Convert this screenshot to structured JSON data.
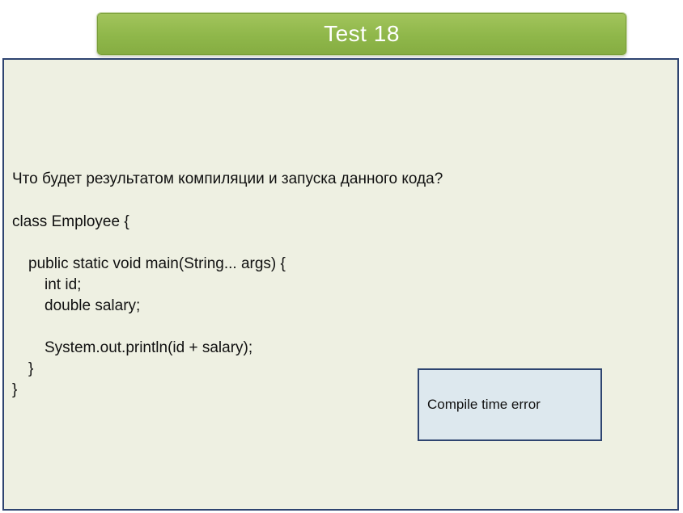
{
  "title": "Test 18",
  "question": "Что будет результатом компиляции и запуска данного кода?",
  "code_lines": [
    "class Employee {",
    "public static void main(String... args) {",
    "int id;",
    "double salary;",
    "System.out.println(id + salary);",
    "}",
    "}"
  ],
  "answer": "Compile time error"
}
